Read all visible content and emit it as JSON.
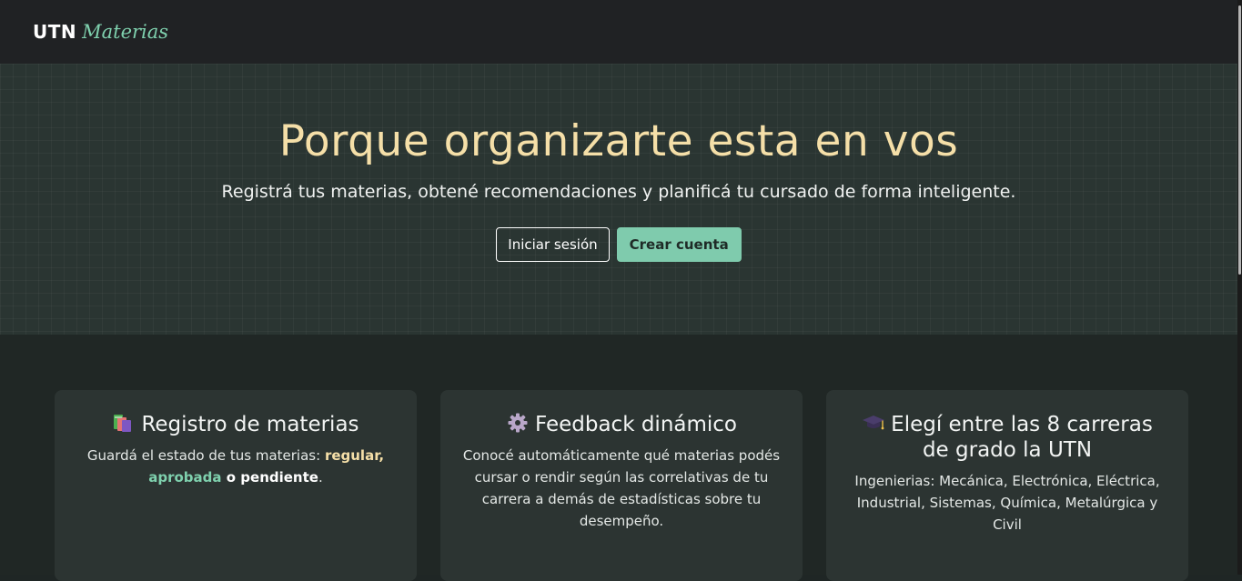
{
  "brand": {
    "utn": "UTN",
    "materias": "Materias"
  },
  "hero": {
    "title": "Porque organizarte esta en vos",
    "subtitle": "Registrá tus materias, obtené recomendaciones y planificá tu cursado de forma inteligente.",
    "login_label": "Iniciar sesión",
    "signup_label": "Crear cuenta"
  },
  "features": [
    {
      "icon": "books-icon",
      "title": "Registro de materias",
      "text_prefix": "Guardá el estado de tus materias: ",
      "state_regular": "regular,",
      "state_aprobada": "aprobada",
      "connector": " o ",
      "state_pendiente": "pendiente",
      "text_suffix": "."
    },
    {
      "icon": "gear-icon",
      "title": "Feedback dinámico",
      "text": "Conocé automáticamente qué materias podés cursar o rendir según las correlativas de tu carrera a demás de estadísticas sobre tu desempeño."
    },
    {
      "icon": "graduation-cap-icon",
      "title": "Elegí entre las 8 carreras de grado la UTN",
      "text": "Ingenierias: Mecánica, Electrónica, Eléctrica, Industrial, Sistemas, Química, Metalúrgica y Civil"
    }
  ],
  "colors": {
    "accent_green": "#7fcbad",
    "accent_gold": "#f5dfa8",
    "navbar": "#202224",
    "hero_bg": "#2a3532",
    "card_bg": "#2c3432"
  }
}
